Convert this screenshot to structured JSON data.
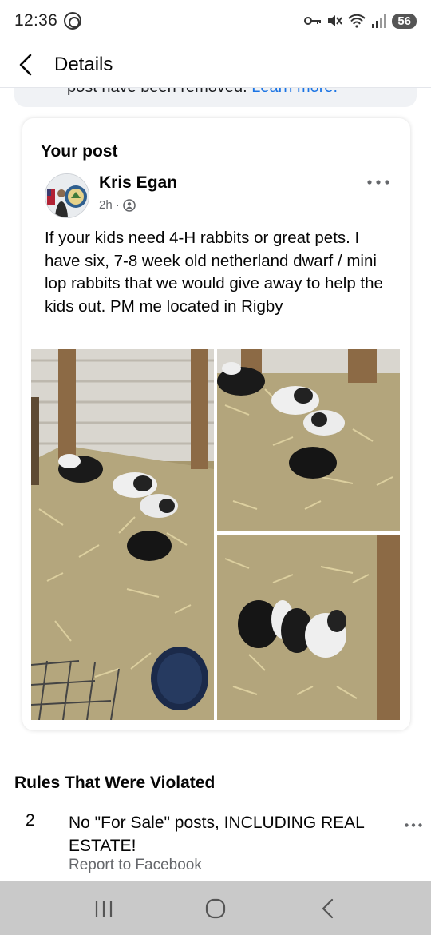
{
  "status_bar": {
    "time": "12:36",
    "battery": "56"
  },
  "header": {
    "title": "Details"
  },
  "notice": {
    "text": "post have been removed. ",
    "link": "Learn more."
  },
  "post": {
    "section_label": "Your post",
    "author": "Kris Egan",
    "time": "2h",
    "meta_separator": "·",
    "body": "If your kids need 4-H rabbits or great pets. I have six, 7-8 week old netherland dwarf / mini lop rabbits that we would give away to help the kids out. PM me located in Rigby",
    "photo_count": 3
  },
  "rules": {
    "title": "Rules That Were Violated",
    "items": [
      {
        "number": "2",
        "text": "No \"For Sale\" posts, INCLUDING REAL ESTATE!",
        "action": "Report to Facebook"
      }
    ]
  },
  "icons": {
    "back": "back-arrow-icon",
    "more": "more-horizontal-icon",
    "audience": "audience-icon",
    "nav": [
      "recent-apps-icon",
      "home-icon",
      "back-icon"
    ]
  },
  "colors": {
    "link": "#1b74e4",
    "secondary_text": "#65676b",
    "banner": "#f0f2f5",
    "nav_bar": "#c9c9c9"
  }
}
